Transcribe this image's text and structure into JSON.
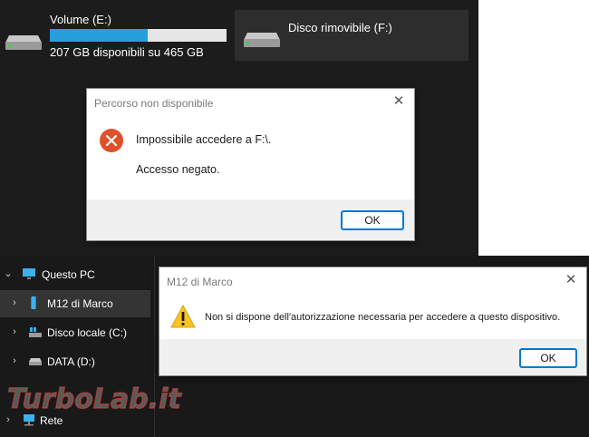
{
  "drives": {
    "volume_e": {
      "name": "Volume (E:)",
      "free_text": "207 GB disponibili su 465 GB",
      "used_fraction": 0.555
    },
    "disk_f": {
      "name": "Disco rimovibile (F:)"
    }
  },
  "dialog_path": {
    "title": "Percorso non disponibile",
    "message": "Impossibile accedere a F:\\.",
    "detail": "Accesso negato.",
    "ok_label": "OK"
  },
  "dialog_permission": {
    "title": "M12 di Marco",
    "message": "Non si dispone dell'autorizzazione necessaria per accedere a questo dispositivo.",
    "ok_label": "OK"
  },
  "nav": {
    "this_pc": "Questo PC",
    "items": [
      {
        "label": "M12 di Marco",
        "icon": "phone-icon",
        "selected": true
      },
      {
        "label": "Disco locale (C:)",
        "icon": "windows-drive-icon"
      },
      {
        "label": "DATA (D:)",
        "icon": "drive-icon"
      }
    ],
    "network": "Rete"
  },
  "watermark": {
    "text": "TurboLab.it"
  },
  "colors": {
    "accent": "#0078d4",
    "usage_bar": "#26a0da",
    "error": "#e0502b",
    "warning": "#f7c325"
  }
}
